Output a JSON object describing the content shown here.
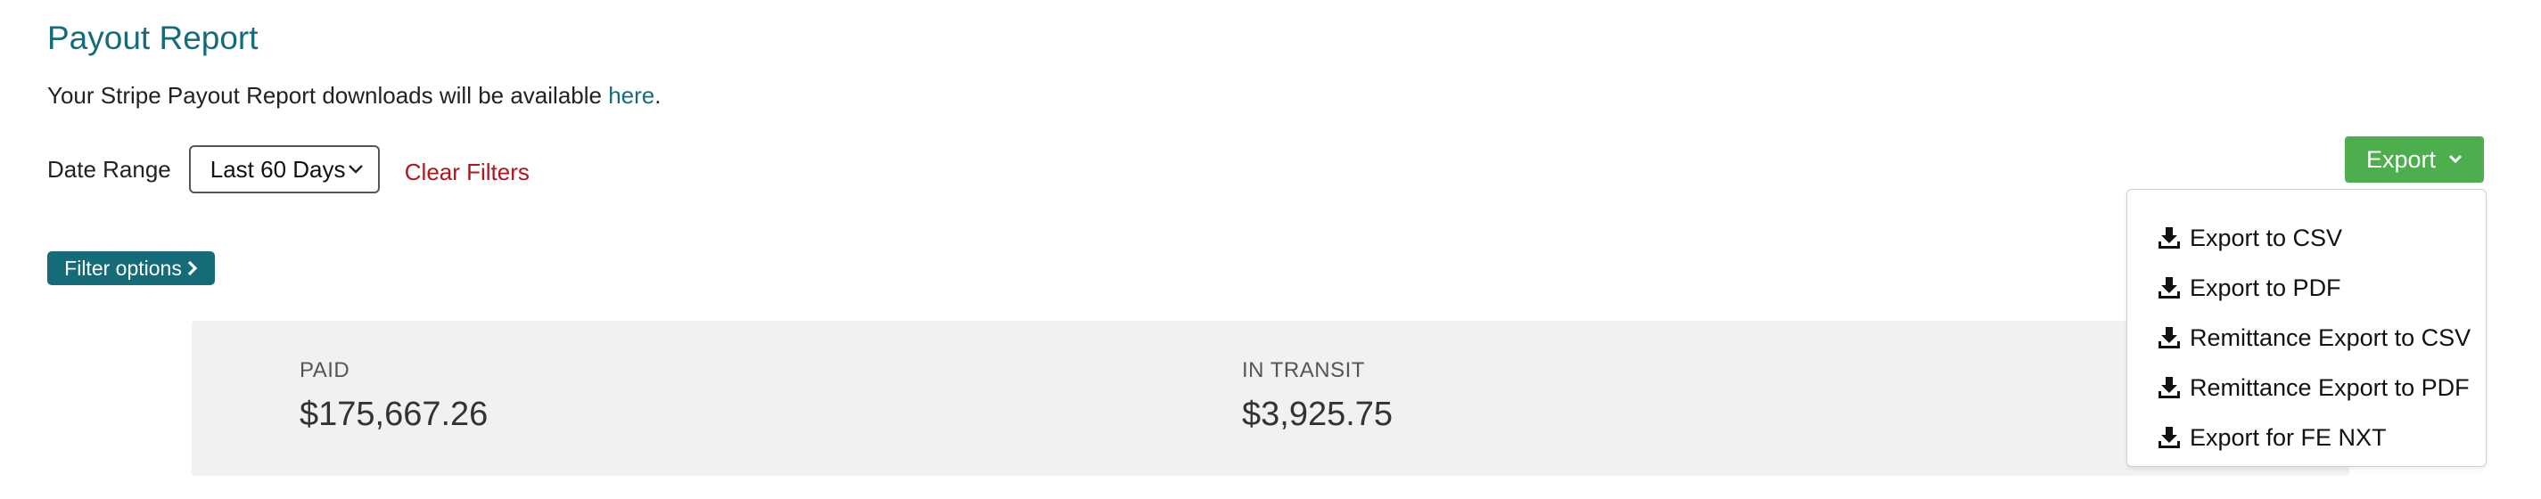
{
  "page": {
    "title": "Payout Report",
    "subtitle_prefix": "Your Stripe Payout Report downloads will be available ",
    "subtitle_link": "here",
    "subtitle_suffix": "."
  },
  "filters": {
    "date_range_label": "Date Range",
    "date_range_value": "Last 60 Days",
    "clear_label": "Clear Filters",
    "filter_options_label": "Filter options"
  },
  "export": {
    "button_label": "Export",
    "menu": [
      {
        "label": "Export to CSV",
        "icon": "download-icon"
      },
      {
        "label": "Export to PDF",
        "icon": "download-icon"
      },
      {
        "label": "Remittance Export to CSV",
        "icon": "download-icon"
      },
      {
        "label": "Remittance Export to PDF",
        "icon": "download-icon"
      },
      {
        "label": "Export for FE NXT",
        "icon": "download-icon"
      }
    ]
  },
  "summary": {
    "paid_label": "PAID",
    "paid_value": "$175,667.26",
    "transit_label": "IN TRANSIT",
    "transit_value": "$3,925.75"
  },
  "colors": {
    "brand_teal": "#166b78",
    "export_green": "#4cae4c",
    "clear_red": "#b3151e",
    "summary_bg": "#f1f1f1"
  }
}
